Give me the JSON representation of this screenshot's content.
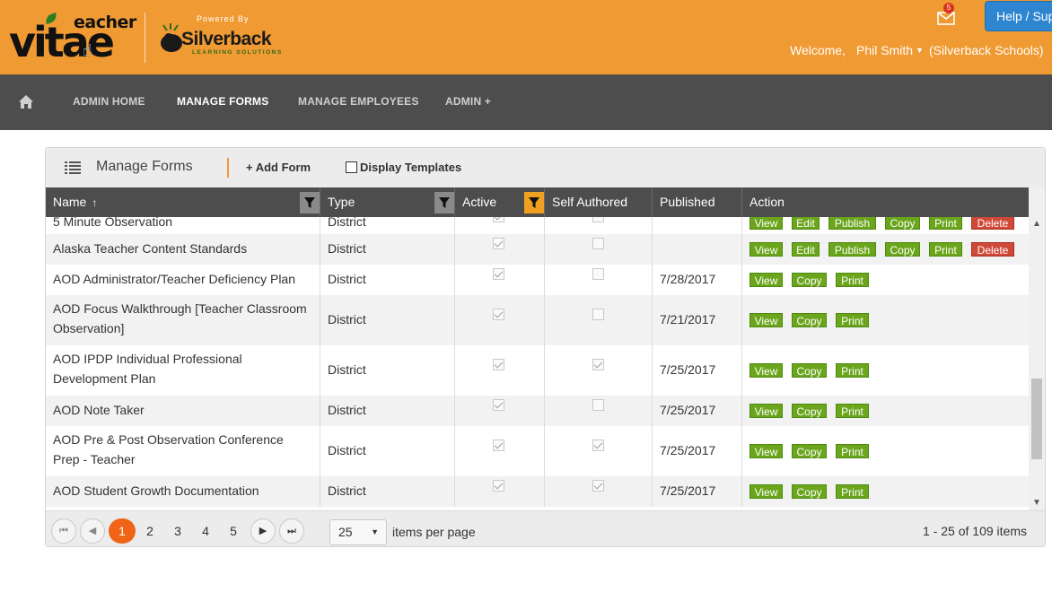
{
  "header": {
    "logo_teacher": "eacher",
    "logo_vitae": "vitae",
    "powered_by": "Powered By",
    "brand_name": "Silverback",
    "brand_sub": "LEARNING SOLUTIONS",
    "mail_count": "5",
    "help_label": "Help / Support",
    "welcome": "Welcome,",
    "user_name": "Phil Smith",
    "school": "(Silverback Schools)"
  },
  "nav": {
    "items": [
      {
        "label": "ADMIN HOME"
      },
      {
        "label": "MANAGE FORMS"
      },
      {
        "label": "MANAGE EMPLOYEES"
      },
      {
        "label": "ADMIN +"
      }
    ]
  },
  "panel": {
    "title": "Manage Forms",
    "add_form": "+ Add Form",
    "display_templates": "Display Templates"
  },
  "grid": {
    "columns": [
      "Name",
      "Type",
      "Active",
      "Self Authored",
      "Published",
      "Action"
    ],
    "sort_indicator": "↑",
    "rows": [
      {
        "name": "5 Minute Observation",
        "name2": "",
        "type": "District",
        "active": true,
        "self": false,
        "published": "",
        "actions": [
          "View",
          "Edit",
          "Publish",
          "Copy",
          "Print",
          "Delete"
        ]
      },
      {
        "name": "Alaska Teacher Content Standards",
        "name2": "",
        "type": "District",
        "active": true,
        "self": false,
        "published": "",
        "actions": [
          "View",
          "Edit",
          "Publish",
          "Copy",
          "Print",
          "Delete"
        ]
      },
      {
        "name": "AOD Administrator/Teacher Deficiency Plan",
        "name2": "",
        "type": "District",
        "active": true,
        "self": false,
        "published": "7/28/2017",
        "actions": [
          "View",
          "Copy",
          "Print"
        ]
      },
      {
        "name": "AOD Focus Walkthrough [Teacher Classroom",
        "name2": "Observation]",
        "type": "District",
        "active": true,
        "self": false,
        "published": "7/21/2017",
        "actions": [
          "View",
          "Copy",
          "Print"
        ]
      },
      {
        "name": "AOD IPDP Individual Professional",
        "name2": "Development Plan",
        "type": "District",
        "active": true,
        "self": true,
        "published": "7/25/2017",
        "actions": [
          "View",
          "Copy",
          "Print"
        ]
      },
      {
        "name": "AOD Note Taker",
        "name2": "",
        "type": "District",
        "active": true,
        "self": false,
        "published": "7/25/2017",
        "actions": [
          "View",
          "Copy",
          "Print"
        ]
      },
      {
        "name": "AOD Pre & Post Observation Conference",
        "name2": "Prep - Teacher",
        "type": "District",
        "active": true,
        "self": true,
        "published": "7/25/2017",
        "actions": [
          "View",
          "Copy",
          "Print"
        ]
      },
      {
        "name": "AOD Student Growth Documentation",
        "name2": "",
        "type": "District",
        "active": true,
        "self": true,
        "published": "7/25/2017",
        "actions": [
          "View",
          "Copy",
          "Print"
        ]
      }
    ]
  },
  "pager": {
    "first_icon": "⏮",
    "prev_icon": "◀",
    "next_icon": "▶",
    "last_icon": "⏭",
    "pages": [
      "1",
      "2",
      "3",
      "4",
      "5"
    ],
    "current_page": "1",
    "per_page": "25",
    "per_page_label": "items per page",
    "info": "1 - 25 of 109 items"
  },
  "colors": {
    "header_bg": "#f09a33",
    "nav_bg": "#4d4d4d",
    "action_green": "#6aa51c",
    "action_red": "#d04838",
    "current_page": "#f06418",
    "help_blue": "#2e86d1"
  }
}
